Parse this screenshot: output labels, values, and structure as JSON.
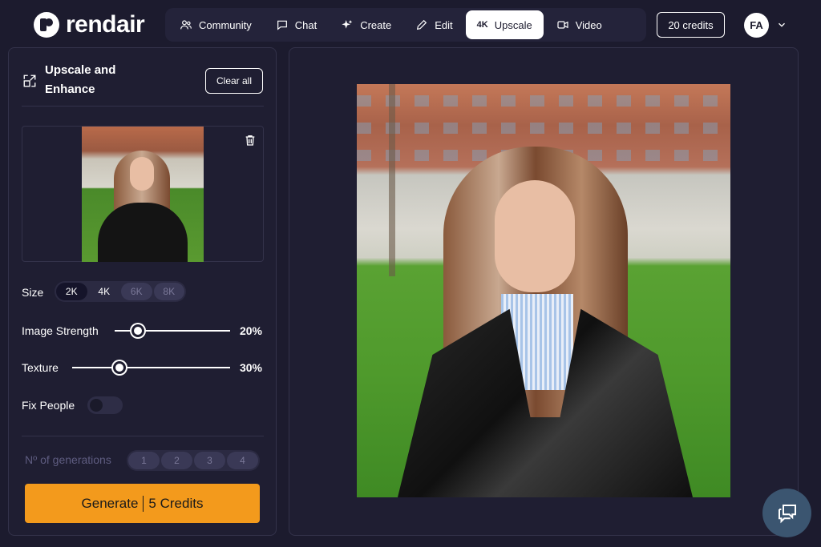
{
  "brand": {
    "name": "rendair"
  },
  "nav": {
    "items": [
      {
        "label": "Community",
        "icon": "users-icon"
      },
      {
        "label": "Chat",
        "icon": "chat-bubble-icon"
      },
      {
        "label": "Create",
        "icon": "sparkle-icon"
      },
      {
        "label": "Edit",
        "icon": "pencil-icon"
      },
      {
        "label": "Upscale",
        "badge": "4K",
        "active": true
      },
      {
        "label": "Video",
        "icon": "video-camera-icon"
      }
    ]
  },
  "header": {
    "credits": "20 credits",
    "avatar_initials": "FA"
  },
  "panel": {
    "title": "Upscale and Enhance",
    "clear_label": "Clear all",
    "size": {
      "label": "Size",
      "options": [
        "2K",
        "4K",
        "6K",
        "8K"
      ],
      "selected": "2K",
      "disabled": [
        "6K",
        "8K"
      ]
    },
    "image_strength": {
      "label": "Image Strength",
      "value": "20%",
      "fraction": 0.2
    },
    "texture": {
      "label": "Texture",
      "value": "30%",
      "fraction": 0.3
    },
    "fix_people": {
      "label": "Fix People",
      "on": false
    },
    "generations": {
      "label": "Nº of generations",
      "options": [
        "1",
        "2",
        "3",
        "4"
      ]
    },
    "generate": {
      "label": "Generate",
      "cost": "5 Credits"
    }
  },
  "colors": {
    "accent": "#f39a1c",
    "background": "#1c1b2e",
    "panel": "#1f1e32"
  }
}
